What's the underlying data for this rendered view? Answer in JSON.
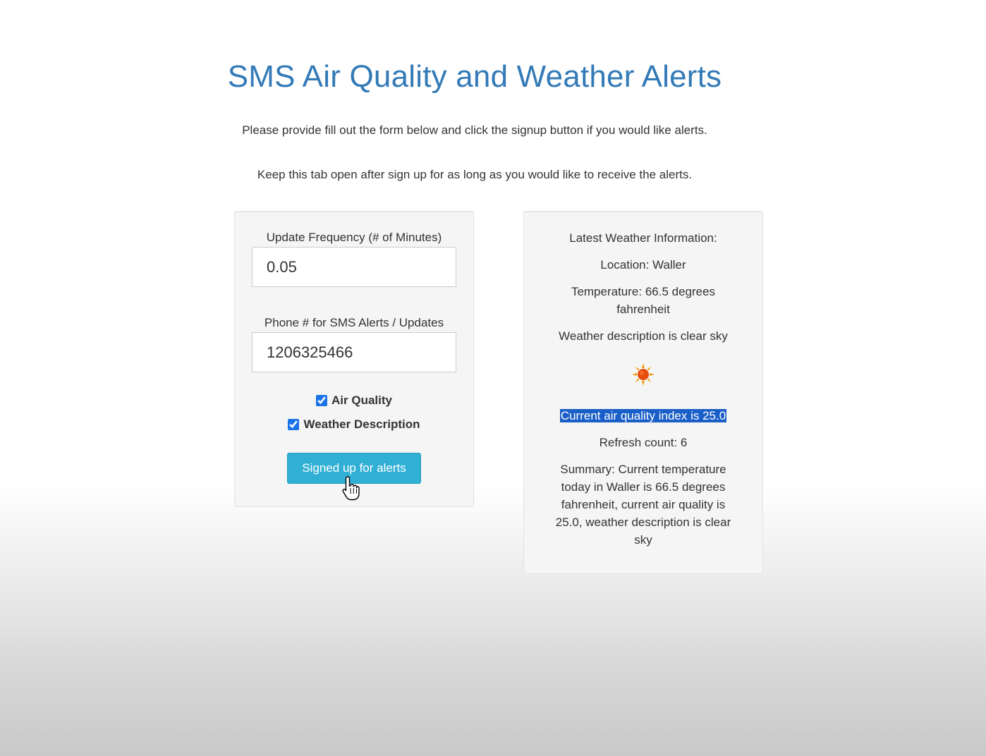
{
  "page": {
    "title": "SMS Air Quality and Weather Alerts",
    "intro_line_1": "Please provide fill out the form below and click the signup button if you would like alerts.",
    "intro_line_2": "Keep this tab open after sign up for as long as you would like to receive the alerts."
  },
  "form": {
    "frequency_label": "Update Frequency (# of Minutes)",
    "frequency_value": "0.05",
    "phone_label": "Phone # for SMS Alerts / Updates",
    "phone_value": "1206325466",
    "checkboxes": [
      {
        "label": "Air Quality",
        "checked": true
      },
      {
        "label": "Weather Description",
        "checked": true
      }
    ],
    "submit_label": "Signed up for alerts"
  },
  "info": {
    "heading": "Latest Weather Information:",
    "location": "Location: Waller",
    "temperature": "Temperature: 66.5 degrees fahrenheit",
    "description": "Weather description is clear sky",
    "weather_icon": "sun-icon",
    "air_quality": "Current air quality index is 25.0",
    "refresh_count": "Refresh count: 6",
    "summary": "Summary: Current temperature today in Waller is 66.5 degrees fahrenheit, current air quality is 25.0, weather description is clear sky"
  },
  "colors": {
    "title": "#337ab7",
    "button": "#31b0d5",
    "selection": "#1a5fc8"
  }
}
